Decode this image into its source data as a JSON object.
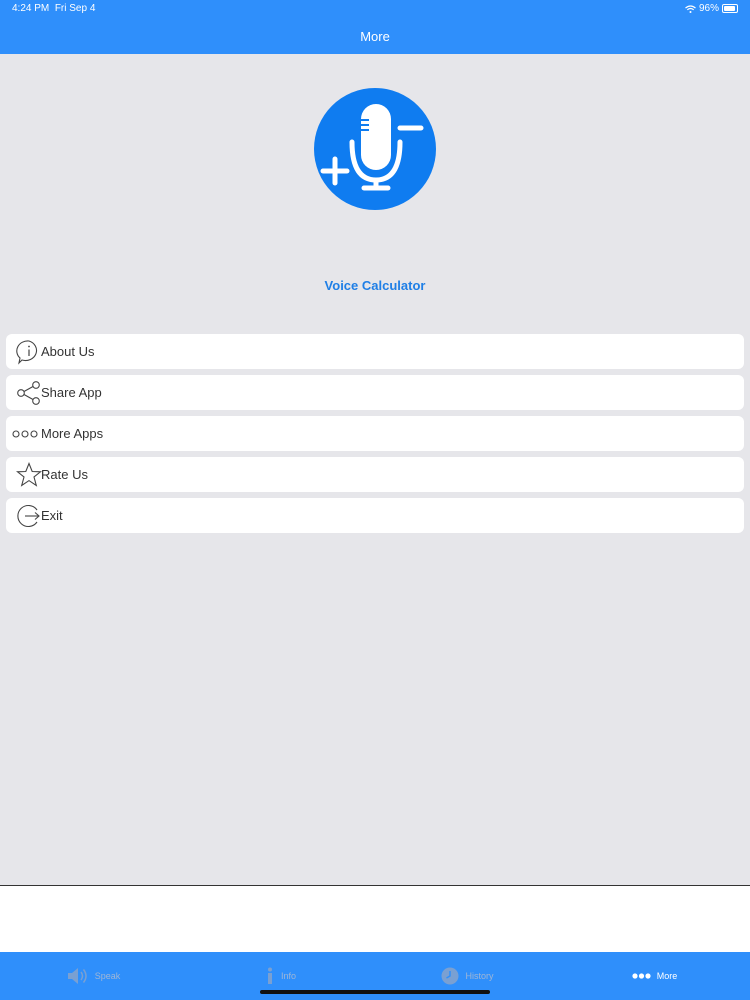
{
  "status": {
    "time": "4:24 PM",
    "date": "Fri Sep 4",
    "battery": "96%"
  },
  "nav": {
    "title": "More"
  },
  "app": {
    "name": "Voice Calculator"
  },
  "menu": [
    {
      "label": "About Us",
      "icon": "info-icon"
    },
    {
      "label": "Share App",
      "icon": "share-icon"
    },
    {
      "label": "More Apps",
      "icon": "more-dots-icon"
    },
    {
      "label": "Rate Us",
      "icon": "star-icon"
    },
    {
      "label": "Exit",
      "icon": "exit-icon"
    }
  ],
  "tabs": [
    {
      "label": "Speak",
      "icon": "speaker-icon"
    },
    {
      "label": "Info",
      "icon": "info-icon"
    },
    {
      "label": "History",
      "icon": "history-icon"
    },
    {
      "label": "More",
      "icon": "more-dots-icon",
      "active": true
    }
  ],
  "colors": {
    "accent": "#2f8ffb",
    "logo": "#0f7cf0",
    "title": "#1f7fe6",
    "background": "#e6e6ea"
  }
}
